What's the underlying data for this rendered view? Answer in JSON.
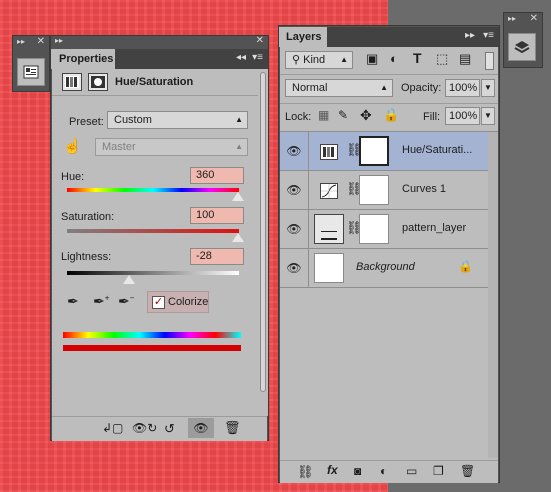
{
  "properties": {
    "tab_label": "Properties",
    "adjustment_title": "Hue/Saturation",
    "preset_label": "Preset:",
    "preset_value": "Custom",
    "channel_value": "Master",
    "hue_label": "Hue:",
    "hue_value": "360",
    "saturation_label": "Saturation:",
    "saturation_value": "100",
    "lightness_label": "Lightness:",
    "lightness_value": "-28",
    "colorize_label": "Colorize",
    "colorize_checked": true,
    "hue_level": 1.0,
    "saturation_level": 1.0,
    "lightness_level": 0.36
  },
  "layers": {
    "tab_label": "Layers",
    "filter_label": "Kind",
    "blend_mode": "Normal",
    "opacity_label": "Opacity:",
    "opacity_value": "100%",
    "lock_label": "Lock:",
    "fill_label": "Fill:",
    "fill_value": "100%",
    "items": [
      {
        "name": "Hue/Saturati...",
        "selected": true
      },
      {
        "name": "Curves 1",
        "selected": false
      },
      {
        "name": "pattern_layer",
        "selected": false
      },
      {
        "name": "Background",
        "selected": false
      }
    ]
  },
  "colors": {
    "canvas": "#f24a4d",
    "panel_bg": "#bdbdbd",
    "selected_row": "#a5b3d3",
    "value_field": "#f0b9b0"
  }
}
